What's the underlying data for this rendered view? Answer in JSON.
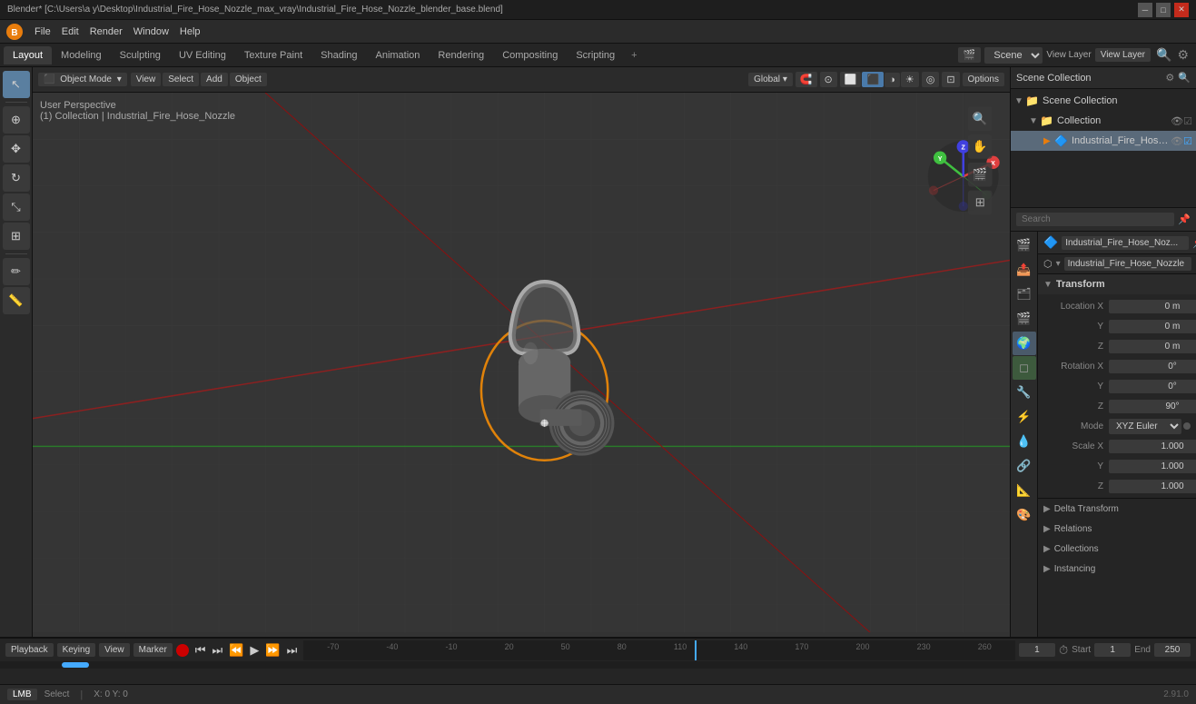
{
  "window": {
    "title": "Blender* [C:\\Users\\a y\\Desktop\\Industrial_Fire_Hose_Nozzle_max_vray\\Industrial_Fire_Hose_Nozzle_blender_base.blend]",
    "min_label": "─",
    "max_label": "□",
    "close_label": "✕"
  },
  "menu": {
    "items": [
      "Blender",
      "File",
      "Edit",
      "Render",
      "Window",
      "Help"
    ]
  },
  "workspace_tabs": {
    "tabs": [
      {
        "label": "Layout",
        "active": true
      },
      {
        "label": "Modeling",
        "active": false
      },
      {
        "label": "Sculpting",
        "active": false
      },
      {
        "label": "UV Editing",
        "active": false
      },
      {
        "label": "Texture Paint",
        "active": false
      },
      {
        "label": "Shading",
        "active": false
      },
      {
        "label": "Animation",
        "active": false
      },
      {
        "label": "Rendering",
        "active": false
      },
      {
        "label": "Compositing",
        "active": false
      },
      {
        "label": "Scripting",
        "active": false
      }
    ],
    "plus_label": "+",
    "scene_label": "Scene",
    "view_layer_label": "View Layer",
    "render_engine_icon": "⚙"
  },
  "viewport_header": {
    "mode_label": "Object Mode",
    "view_label": "View",
    "select_label": "Select",
    "add_label": "Add",
    "object_label": "Object",
    "global_label": "Global",
    "options_label": "Options"
  },
  "viewport": {
    "info_line1": "User Perspective",
    "info_line2": "(1) Collection | Industrial_Fire_Hose_Nozzle"
  },
  "tools": {
    "items": [
      {
        "icon": "↖",
        "label": "select",
        "active": true
      },
      {
        "icon": "⊕",
        "label": "cursor",
        "active": false
      },
      {
        "icon": "⤢",
        "label": "move",
        "active": false
      },
      {
        "icon": "↻",
        "label": "rotate",
        "active": false
      },
      {
        "icon": "⤡",
        "label": "scale",
        "active": false
      },
      {
        "icon": "T",
        "label": "transform",
        "active": false
      },
      {
        "icon": "✏",
        "label": "annotate",
        "active": false
      },
      {
        "icon": "📏",
        "label": "measure",
        "active": false
      }
    ]
  },
  "outliner": {
    "title": "Scene Collection",
    "search_placeholder": "Search",
    "rows": [
      {
        "indent": 0,
        "has_arrow": true,
        "arrow": "▼",
        "icon": "📁",
        "label": "Scene Collection",
        "show_eye": false,
        "eye": ""
      },
      {
        "indent": 1,
        "has_arrow": true,
        "arrow": "▼",
        "icon": "📁",
        "label": "Collection",
        "show_eye": true,
        "eye": "👁"
      },
      {
        "indent": 2,
        "has_arrow": true,
        "arrow": "▶",
        "icon": "🔷",
        "label": "Industrial_Fire_Hose...",
        "show_eye": true,
        "eye": "👁",
        "active": true
      }
    ]
  },
  "properties": {
    "object_name": "Industrial_Fire_Hose_Noz...",
    "data_name": "Industrial_Fire_Hose_Nozzle",
    "transform": {
      "title": "Transform",
      "location_x": "0 m",
      "location_y": "0 m",
      "location_z": "0 m",
      "rotation_x": "0°",
      "rotation_y": "0°",
      "rotation_z": "90°",
      "mode_label": "Mode",
      "mode_value": "XYZ Euler",
      "scale_x": "1.000",
      "scale_y": "1.000",
      "scale_z": "1.000"
    },
    "sections": [
      {
        "label": "Delta Transform",
        "collapsed": true
      },
      {
        "label": "Relations",
        "collapsed": true
      },
      {
        "label": "Collections",
        "collapsed": true
      },
      {
        "label": "Instancing",
        "collapsed": true
      }
    ],
    "tabs": [
      {
        "icon": "🔧",
        "label": "tool",
        "active": false
      },
      {
        "icon": "⬡",
        "label": "scene",
        "active": false
      },
      {
        "icon": "🌍",
        "label": "world",
        "active": false
      },
      {
        "icon": "▽",
        "label": "object",
        "active": true
      },
      {
        "icon": "🔲",
        "label": "modifier",
        "active": false
      },
      {
        "icon": "⚡",
        "label": "particles",
        "active": false
      },
      {
        "icon": "💧",
        "label": "physics",
        "active": false
      },
      {
        "icon": "🔗",
        "label": "constraint",
        "active": false
      },
      {
        "icon": "📐",
        "label": "data",
        "active": false
      },
      {
        "icon": "🎨",
        "label": "material",
        "active": false
      }
    ]
  },
  "timeline": {
    "playback_label": "Playback",
    "keying_label": "Keying",
    "view_label": "View",
    "marker_label": "Marker",
    "current_frame": "1",
    "start_label": "Start",
    "start_frame": "1",
    "end_label": "End",
    "end_frame": "250",
    "transport_icons": [
      "⏮",
      "⏭",
      "⏪",
      "▶",
      "⏩",
      "⏭"
    ]
  },
  "status_bar": {
    "select_label": "Select",
    "version": "2.91.0"
  }
}
